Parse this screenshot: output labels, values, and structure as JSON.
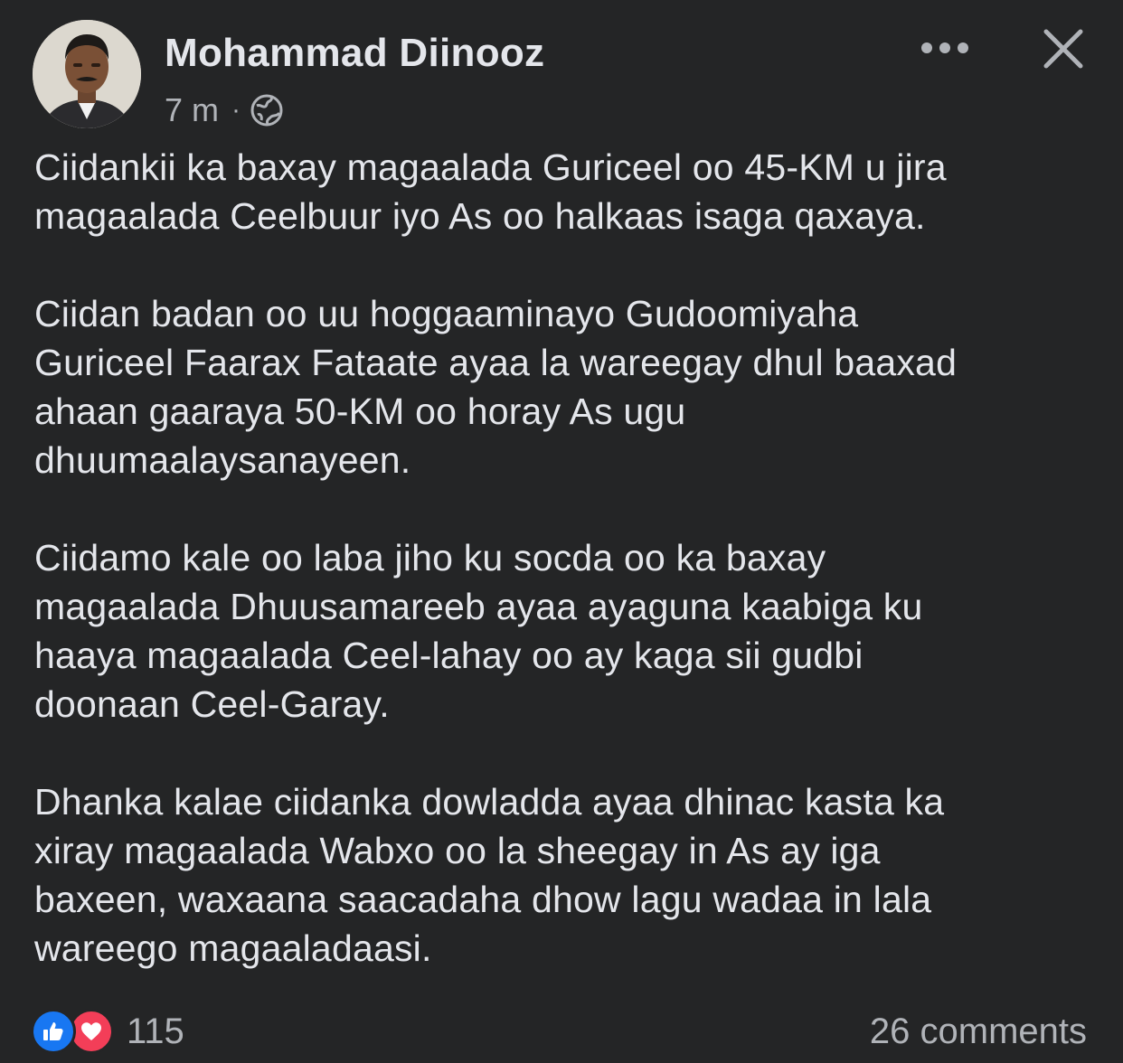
{
  "post": {
    "author": "Mohammad Diinooz",
    "time": "7 m",
    "separator": "·",
    "paragraphs": [
      "Ciidankii ka baxay magaalada Guriceel oo 45-KM u jira\nmagaalada Ceelbuur iyo As oo halkaas isaga qaxaya.",
      "Ciidan badan oo uu hoggaaminayo Gudoomiyaha\nGuriceel Faarax Fataate ayaa la wareegay dhul baaxad\nahaan gaaraya 50-KM oo horay As ugu\ndhuumaalaysanayeen.",
      "Ciidamo kale oo laba jiho ku socda oo ka baxay\nmagaalada Dhuusamareeb ayaa ayaguna kaabiga ku\nhaaya magaalada Ceel-lahay oo ay kaga sii gudbi\ndoonaan Ceel-Garay.",
      "Dhanka kalae ciidanka dowladda ayaa dhinac kasta ka\nxiray magaalada Wabxo oo la sheegay in As ay iga\nbaxeen, waxaana saacadaha dhow lagu wadaa in lala\nwareego magaaladaasi."
    ]
  },
  "icons": {
    "privacy": "globe-icon",
    "more": "more-dots-icon",
    "close": "close-icon",
    "like": "like-icon",
    "love": "love-icon"
  },
  "footer": {
    "reaction_count": "115",
    "comments": "26 comments"
  },
  "colors": {
    "background": "#242526",
    "primary_text": "#e4e6eb",
    "secondary_text": "#b0b3b8",
    "like_blue": "#1877f2",
    "love_red": "#f33e58"
  }
}
